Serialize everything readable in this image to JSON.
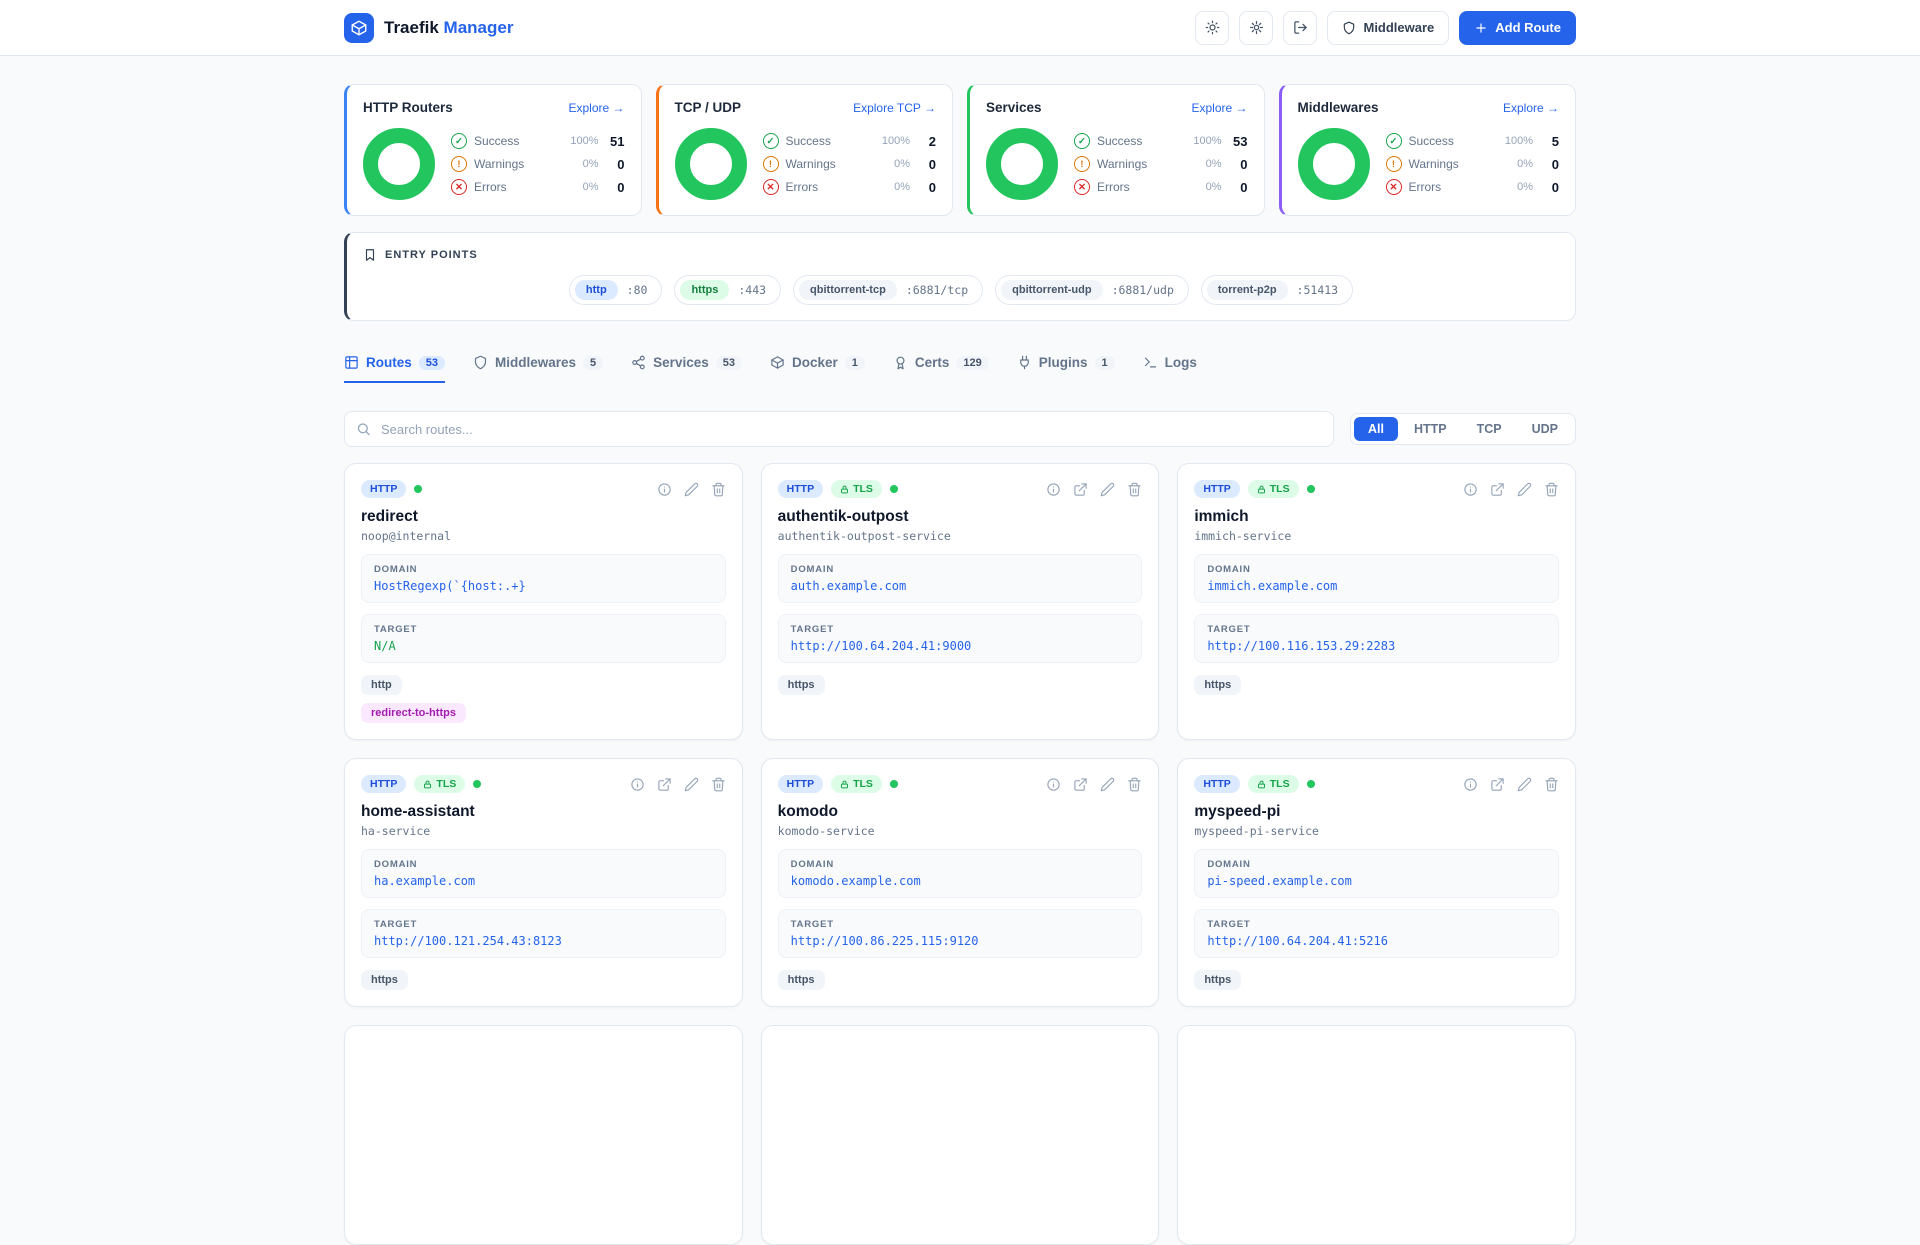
{
  "header": {
    "brand_primary": "Traefik",
    "brand_accent": "Manager",
    "middleware_button": "Middleware",
    "add_route_button": "Add Route"
  },
  "stats": [
    {
      "title": "HTTP Routers",
      "explore": "Explore →",
      "accent": "#3b82f6",
      "rows": [
        {
          "label": "Success",
          "percent": "100%",
          "count": "51"
        },
        {
          "label": "Warnings",
          "percent": "0%",
          "count": "0"
        },
        {
          "label": "Errors",
          "percent": "0%",
          "count": "0"
        }
      ]
    },
    {
      "title": "TCP / UDP",
      "explore": "Explore TCP →",
      "accent": "#f97316",
      "rows": [
        {
          "label": "Success",
          "percent": "100%",
          "count": "2"
        },
        {
          "label": "Warnings",
          "percent": "0%",
          "count": "0"
        },
        {
          "label": "Errors",
          "percent": "0%",
          "count": "0"
        }
      ]
    },
    {
      "title": "Services",
      "explore": "Explore →",
      "accent": "#22c55e",
      "rows": [
        {
          "label": "Success",
          "percent": "100%",
          "count": "53"
        },
        {
          "label": "Warnings",
          "percent": "0%",
          "count": "0"
        },
        {
          "label": "Errors",
          "percent": "0%",
          "count": "0"
        }
      ]
    },
    {
      "title": "Middlewares",
      "explore": "Explore →",
      "accent": "#8b5cf6",
      "rows": [
        {
          "label": "Success",
          "percent": "100%",
          "count": "5"
        },
        {
          "label": "Warnings",
          "percent": "0%",
          "count": "0"
        },
        {
          "label": "Errors",
          "percent": "0%",
          "count": "0"
        }
      ]
    }
  ],
  "entry_points": {
    "title": "ENTRY POINTS",
    "items": [
      {
        "name": "http",
        "port": ":80",
        "color": "#1d4ed8"
      },
      {
        "name": "https",
        "port": ":443",
        "color": "#15803d"
      },
      {
        "name": "qbittorrent-tcp",
        "port": ":6881/tcp",
        "color": "#475569"
      },
      {
        "name": "qbittorrent-udp",
        "port": ":6881/udp",
        "color": "#475569"
      },
      {
        "name": "torrent-p2p",
        "port": ":51413",
        "color": "#475569"
      }
    ]
  },
  "tabs": [
    {
      "label": "Routes",
      "count": "53"
    },
    {
      "label": "Middlewares",
      "count": "5"
    },
    {
      "label": "Services",
      "count": "53"
    },
    {
      "label": "Docker",
      "count": "1"
    },
    {
      "label": "Certs",
      "count": "129"
    },
    {
      "label": "Plugins",
      "count": "1"
    },
    {
      "label": "Logs"
    }
  ],
  "search_placeholder": "Search routes...",
  "filters": [
    "All",
    "HTTP",
    "TCP",
    "UDP"
  ],
  "labels": {
    "domain": "DOMAIN",
    "target": "TARGET",
    "http_badge": "HTTP",
    "tls_badge": "TLS"
  },
  "routes": [
    {
      "name": "redirect",
      "service": "noop@internal",
      "domain": "HostRegexp(`{host:.+}",
      "target": "N/A",
      "entrypoint": "http",
      "middleware": "redirect-to-https"
    },
    {
      "name": "authentik-outpost",
      "service": "authentik-outpost-service",
      "domain": "auth.example.com",
      "target": "http://100.64.204.41:9000",
      "entrypoint": "https"
    },
    {
      "name": "immich",
      "service": "immich-service",
      "domain": "immich.example.com",
      "target": "http://100.116.153.29:2283",
      "entrypoint": "https"
    },
    {
      "name": "home-assistant",
      "service": "ha-service",
      "domain": "ha.example.com",
      "target": "http://100.121.254.43:8123",
      "entrypoint": "https"
    },
    {
      "name": "komodo",
      "service": "komodo-service",
      "domain": "komodo.example.com",
      "target": "http://100.86.225.115:9120",
      "entrypoint": "https"
    },
    {
      "name": "myspeed-pi",
      "service": "myspeed-pi-service",
      "domain": "pi-speed.example.com",
      "target": "http://100.64.204.41:5216",
      "entrypoint": "https"
    }
  ],
  "colors": {
    "success": "#22c55e",
    "warning": "#d97706",
    "error": "#dc2626",
    "accent": "#2563eb"
  }
}
